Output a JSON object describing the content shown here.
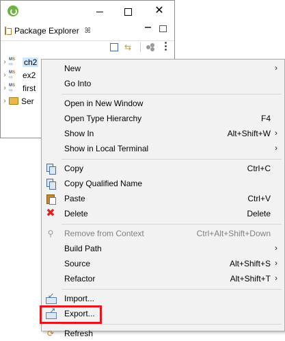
{
  "window": {
    "minimize_icon": "minimize-icon",
    "maximize_icon": "maximize-icon",
    "close_glyph": "✕"
  },
  "view": {
    "tab_label": "Package Explorer",
    "tab_close_glyph": "ꕤ"
  },
  "tree": [
    {
      "label": "ch2",
      "type": "project",
      "selected": true
    },
    {
      "label": "ex2",
      "type": "project"
    },
    {
      "label": "first",
      "type": "project"
    },
    {
      "label": "Ser",
      "type": "folder"
    }
  ],
  "menu": {
    "new": {
      "label": "New",
      "submenu": true
    },
    "go_into": {
      "label": "Go Into"
    },
    "open_new_window": {
      "label": "Open in New Window"
    },
    "open_type_hierarchy": {
      "label": "Open Type Hierarchy",
      "shortcut": "F4"
    },
    "show_in": {
      "label": "Show In",
      "shortcut": "Alt+Shift+W",
      "submenu": true
    },
    "show_local_terminal": {
      "label": "Show in Local Terminal",
      "submenu": true
    },
    "copy": {
      "label": "Copy",
      "shortcut": "Ctrl+C"
    },
    "copy_qualified": {
      "label": "Copy Qualified Name"
    },
    "paste": {
      "label": "Paste",
      "shortcut": "Ctrl+V"
    },
    "delete": {
      "label": "Delete",
      "shortcut": "Delete"
    },
    "remove_context": {
      "label": "Remove from Context",
      "shortcut": "Ctrl+Alt+Shift+Down",
      "disabled": true
    },
    "build_path": {
      "label": "Build Path",
      "submenu": true
    },
    "source": {
      "label": "Source",
      "shortcut": "Alt+Shift+S",
      "submenu": true
    },
    "refactor": {
      "label": "Refactor",
      "shortcut": "Alt+Shift+T",
      "submenu": true
    },
    "import": {
      "label": "Import..."
    },
    "export": {
      "label": "Export..."
    },
    "refresh": {
      "label": "Refresh"
    },
    "submenu_arrow": "›"
  },
  "colors": {
    "menu_bg": "#f2f2f2",
    "highlight_border": "#e3161e",
    "selection_bg": "#cce8ff"
  }
}
